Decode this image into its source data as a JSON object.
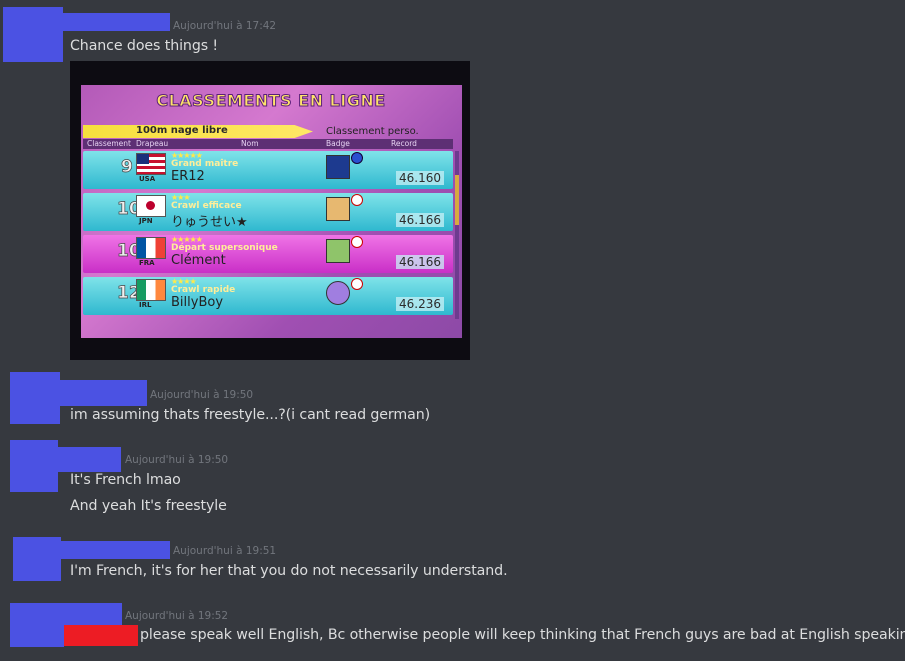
{
  "messages": [
    {
      "timestamp": "Aujourd'hui à 17:42",
      "lines": [
        "Chance does things !"
      ]
    },
    {
      "timestamp": "Aujourd'hui à 19:50",
      "lines": [
        "im assuming thats freestyle...?(i cant read german)"
      ]
    },
    {
      "timestamp": "Aujourd'hui à 19:50",
      "lines": [
        "It's French lmao",
        "And yeah It's freestyle"
      ]
    },
    {
      "timestamp": "Aujourd'hui à 19:51",
      "lines": [
        "I'm French, it's for her that you do not necessarily understand."
      ]
    },
    {
      "timestamp": "Aujourd'hui à 19:52",
      "lines": [
        "please speak well English, Bc otherwise people will keep thinking that French guys are bad at English speaking lol"
      ]
    }
  ],
  "screenshot": {
    "title": "CLASSEMENTS EN LIGNE",
    "course": "100m nage libre",
    "mode": "Classement perso.",
    "headers": [
      "Classement",
      "Drapeau",
      "Nom",
      "Badge",
      "Record"
    ],
    "rows": [
      {
        "rank": "9",
        "country": "USA",
        "stars": "★★★★★",
        "title": "Grand maître",
        "name": "ER12",
        "record": "46.160",
        "color": "cyan"
      },
      {
        "rank": "10",
        "country": "JPN",
        "stars": "★★★",
        "title": "Crawl efficace",
        "name": "りゅうせい★",
        "record": "46.166",
        "color": "cyan"
      },
      {
        "rank": "10",
        "country": "FRA",
        "stars": "★★★★★",
        "title": "Départ supersonique",
        "name": "Clément",
        "record": "46.166",
        "color": "pink"
      },
      {
        "rank": "12",
        "country": "IRL",
        "stars": "★★★★",
        "title": "Crawl rapide",
        "name": "BillyBoy",
        "record": "46.236",
        "color": "cyan"
      }
    ]
  },
  "colors": {
    "background": "#36393f",
    "redaction": "#4b52e3",
    "redaction_red": "#ed1c24",
    "text": "#dcddde",
    "timestamp": "#72767d"
  }
}
